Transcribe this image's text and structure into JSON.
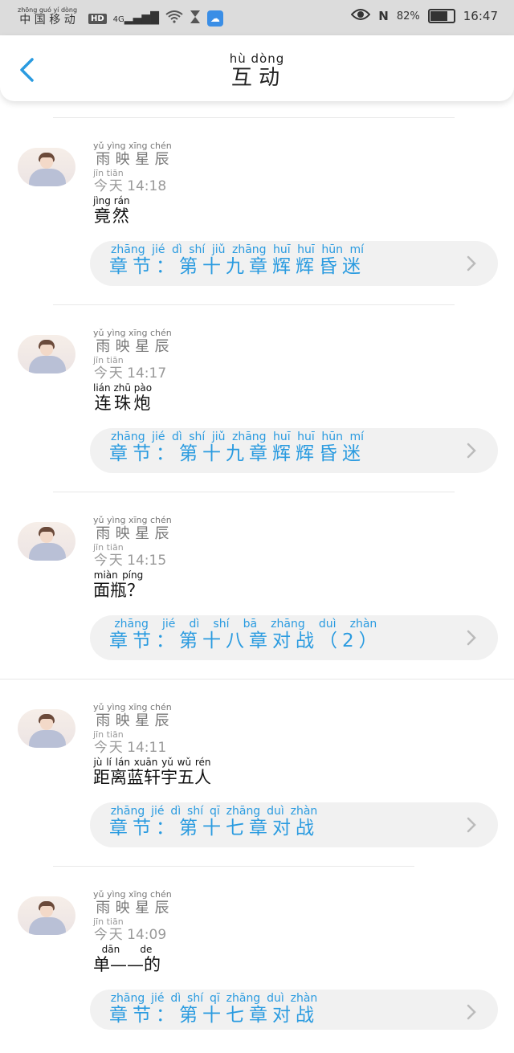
{
  "status_bar": {
    "carrier_pinyin": "zhōng guó yí dòng",
    "carrier": "中国移动",
    "hd": "HD",
    "network": "4G",
    "battery": "82%",
    "battery_level": 0.82,
    "time": "16:47"
  },
  "header": {
    "title": "互动",
    "title_pinyin": "hù dòng",
    "back_icon": "back-chevron-icon"
  },
  "comments": [
    {
      "user": "雨映星辰",
      "user_pinyin": "yǔ yìng xīng chén",
      "time_label": "今天",
      "time_pinyin": "jīn tiān",
      "time": "14:18",
      "text": "竟然",
      "text_pinyin": "jìng rán",
      "chapter": "章节：第十九章辉辉昏迷",
      "chapter_pinyin": "zhāng jié dì shí jiǔ zhāng huī huī hūn mí"
    },
    {
      "user": "雨映星辰",
      "user_pinyin": "yǔ yìng xīng chén",
      "time_label": "今天",
      "time_pinyin": "jīn tiān",
      "time": "14:17",
      "text": "连珠炮",
      "text_pinyin": "lián zhū pào",
      "chapter": "章节：第十九章辉辉昏迷",
      "chapter_pinyin": "zhāng jié dì shí jiǔ zhāng huī huī hūn mí"
    },
    {
      "user": "雨映星辰",
      "user_pinyin": "yǔ yìng xīng chén",
      "time_label": "今天",
      "time_pinyin": "jīn tiān",
      "time": "14:15",
      "text": "面瓶？",
      "text_pinyin": "miàn píng",
      "chapter": "章节：第十八章对战（2）",
      "chapter_pinyin": "zhāng jié dì shí bā zhāng duì zhàn"
    },
    {
      "user": "雨映星辰",
      "user_pinyin": "yǔ yìng xīng chén",
      "time_label": "今天",
      "time_pinyin": "jīn tiān",
      "time": "14:11",
      "text": "距离蓝轩宇五人",
      "text_pinyin": "jù lí lán xuān yǔ wǔ rén",
      "chapter": "章节：第十七章对战",
      "chapter_pinyin": "zhāng jié dì shí qī zhāng duì zhàn"
    },
    {
      "user": "雨映星辰",
      "user_pinyin": "yǔ yìng xīng chén",
      "time_label": "今天",
      "time_pinyin": "jīn tiān",
      "time": "14:09",
      "text": "单——的",
      "text_pinyin": "dān de",
      "chapter": "章节：第十七章对战",
      "chapter_pinyin": "zhāng jié dì shí qī zhāng duì zhàn"
    }
  ],
  "colors": {
    "accent": "#2a9be0",
    "status_bar": "#dcdcdc",
    "chapter_bg": "#f1f1f1"
  }
}
